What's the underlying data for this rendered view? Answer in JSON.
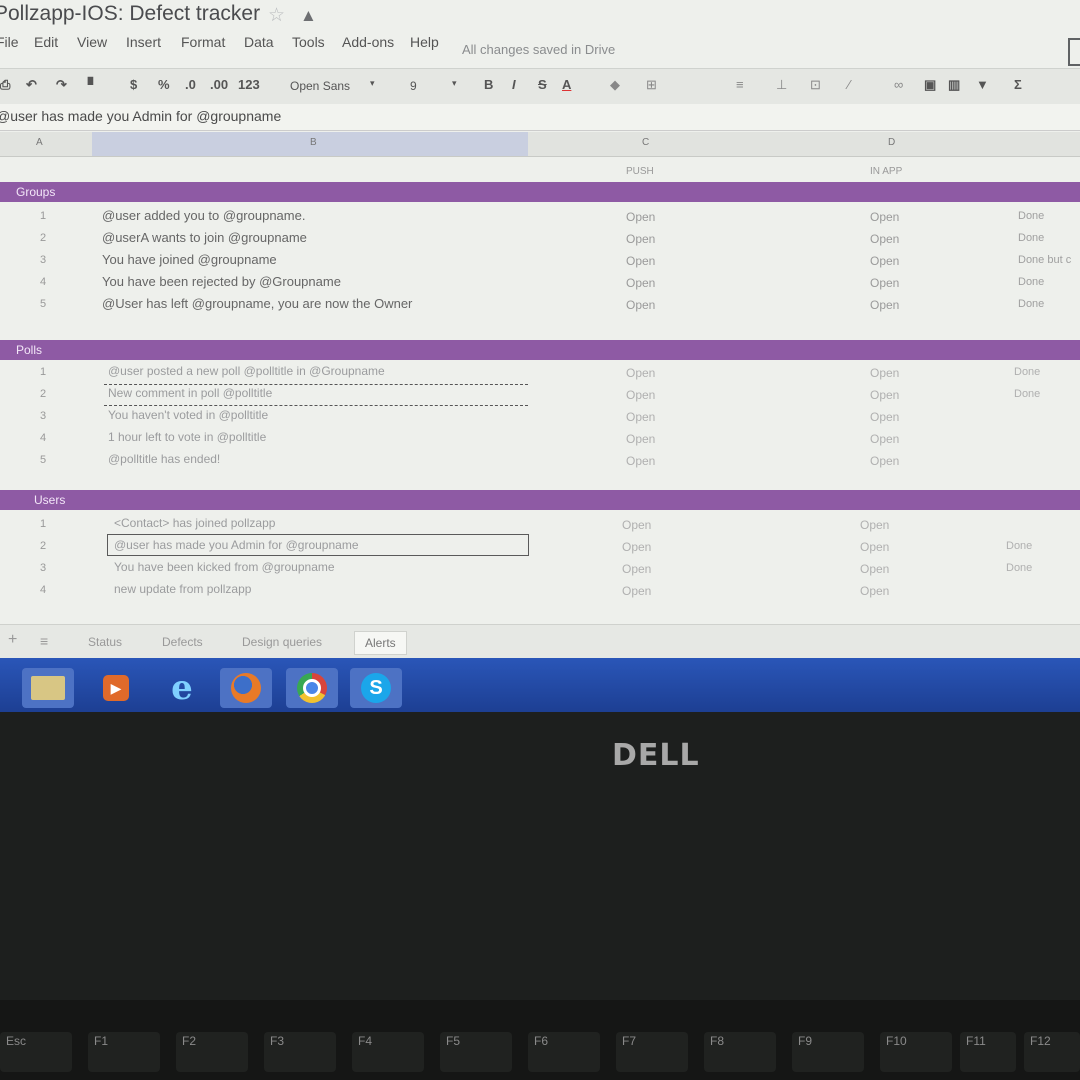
{
  "window": {
    "title": "Pollzapp-IOS: Defect tracker"
  },
  "menu": [
    "File",
    "Edit",
    "View",
    "Insert",
    "Format",
    "Data",
    "Tools",
    "Add-ons",
    "Help"
  ],
  "menu_status": "All changes saved in Drive",
  "toolbar": {
    "font": "Open Sans",
    "size": "9",
    "currency": "$",
    "percent": "%",
    "dec_less": ".0",
    "dec_more": ".00",
    "more_formats": "123"
  },
  "formula_bar": {
    "value": "@user has made you Admin for @groupname"
  },
  "columns": {
    "a": "A",
    "b": "B",
    "c": "C",
    "d": "D"
  },
  "subheaders": {
    "push": "PUSH",
    "in_app": "IN APP"
  },
  "sections": [
    {
      "label": "Groups",
      "rows": [
        {
          "num": "1",
          "text": "@user added you to @groupname.",
          "push": "Open",
          "in_app": "Open",
          "status": "Done"
        },
        {
          "num": "2",
          "text": "@userA wants to join @groupname",
          "push": "Open",
          "in_app": "Open",
          "status": "Done"
        },
        {
          "num": "3",
          "text": "You have joined @groupname",
          "push": "Open",
          "in_app": "Open",
          "status": "Done but c"
        },
        {
          "num": "4",
          "text": "You have been rejected by @Groupname",
          "push": "Open",
          "in_app": "Open",
          "status": "Done"
        },
        {
          "num": "5",
          "text": "@User has left @groupname, you are now the Owner",
          "push": "Open",
          "in_app": "Open",
          "status": "Done"
        }
      ]
    },
    {
      "label": "Polls",
      "rows": [
        {
          "num": "1",
          "text": "@user posted a new poll @polltitle in @Groupname",
          "push": "Open",
          "in_app": "Open",
          "status": "Done"
        },
        {
          "num": "2",
          "text": "New comment in poll @polltitle",
          "push": "Open",
          "in_app": "Open",
          "status": "Done"
        },
        {
          "num": "3",
          "text": "You haven't voted in @polltitle",
          "push": "Open",
          "in_app": "Open",
          "status": ""
        },
        {
          "num": "4",
          "text": "1 hour left to vote in @polltitle",
          "push": "Open",
          "in_app": "Open",
          "status": ""
        },
        {
          "num": "5",
          "text": "@polltitle has ended!",
          "push": "Open",
          "in_app": "Open",
          "status": ""
        }
      ]
    },
    {
      "label": "Users",
      "rows": [
        {
          "num": "1",
          "text": "<Contact> has joined pollzapp",
          "push": "Open",
          "in_app": "Open",
          "status": ""
        },
        {
          "num": "2",
          "text": "@user has made you Admin for @groupname",
          "push": "Open",
          "in_app": "Open",
          "status": "Done"
        },
        {
          "num": "3",
          "text": "You have been kicked from @groupname",
          "push": "Open",
          "in_app": "Open",
          "status": "Done"
        },
        {
          "num": "4",
          "text": "new update from pollzapp",
          "push": "Open",
          "in_app": "Open",
          "status": ""
        }
      ]
    }
  ],
  "sheet_tabs": [
    "Status",
    "Defects",
    "Design queries",
    "Alerts"
  ],
  "taskbar_icons": [
    "file-explorer-icon",
    "media-player-icon",
    "internet-explorer-icon",
    "firefox-icon",
    "chrome-icon",
    "skype-icon"
  ],
  "laptop": {
    "brand": "DELL"
  },
  "keys": [
    "Esc",
    "F1",
    "F2",
    "F3",
    "F4",
    "F5",
    "F6",
    "F7",
    "F8",
    "F9",
    "F10",
    "F11",
    "F12"
  ],
  "colors": {
    "section_header": "#8e5aa4",
    "taskbar": "#2a56b8",
    "selected_col": "#c9cfe0"
  }
}
